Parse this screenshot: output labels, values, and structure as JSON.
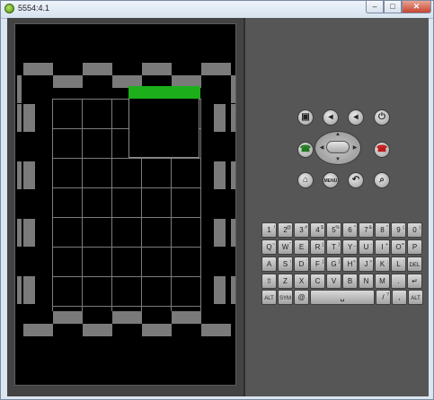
{
  "window": {
    "title": "5554:4.1",
    "minimize_label": "–",
    "maximize_label": "□",
    "close_label": "✕"
  },
  "colors": {
    "dialog_bar": "#1cae1b",
    "checker_cell": "#7a7a7a",
    "screen_bg": "#000000",
    "panel_bg": "#565656"
  },
  "hardware_buttons": {
    "row1": [
      {
        "name": "camera-button",
        "icon": "camera-icon",
        "glyph": "▣"
      },
      {
        "name": "volume-down-button",
        "icon": "volume-down-icon",
        "glyph": "◂"
      },
      {
        "name": "volume-up-button",
        "icon": "volume-up-icon",
        "glyph": "◂"
      },
      {
        "name": "power-button",
        "icon": "power-icon",
        "glyph": "⏻"
      }
    ],
    "call": {
      "glyph": "☎"
    },
    "end_call": {
      "glyph": "☎"
    },
    "row3": [
      {
        "name": "home-button",
        "icon": "home-icon",
        "glyph": "⌂"
      },
      {
        "name": "menu-button",
        "icon": "menu-icon",
        "glyph": "MENU"
      },
      {
        "name": "back-button",
        "icon": "back-icon",
        "glyph": "↶"
      },
      {
        "name": "search-button",
        "icon": "search-icon",
        "glyph": "⌕"
      }
    ]
  },
  "keyboard": {
    "row1": [
      {
        "k": "1",
        "s": "!"
      },
      {
        "k": "2",
        "s": "@"
      },
      {
        "k": "3",
        "s": "#"
      },
      {
        "k": "4",
        "s": "$"
      },
      {
        "k": "5",
        "s": "%"
      },
      {
        "k": "6",
        "s": "^"
      },
      {
        "k": "7",
        "s": "&"
      },
      {
        "k": "8",
        "s": "*"
      },
      {
        "k": "9",
        "s": "("
      },
      {
        "k": "0",
        "s": ")"
      }
    ],
    "row2": [
      {
        "k": "Q",
        "s": "~"
      },
      {
        "k": "W",
        "s": "\""
      },
      {
        "k": "E",
        "s": "`"
      },
      {
        "k": "R",
        "s": "{"
      },
      {
        "k": "T",
        "s": "}"
      },
      {
        "k": "Y",
        "s": "_"
      },
      {
        "k": "U",
        "s": "-"
      },
      {
        "k": "I",
        "s": "+"
      },
      {
        "k": "O",
        "s": "="
      },
      {
        "k": "P",
        "s": ""
      }
    ],
    "row3": [
      {
        "k": "A",
        "s": ""
      },
      {
        "k": "S",
        "s": "\\"
      },
      {
        "k": "D",
        "s": "'"
      },
      {
        "k": "F",
        "s": "["
      },
      {
        "k": "G",
        "s": "]"
      },
      {
        "k": "H",
        "s": "<"
      },
      {
        "k": "J",
        "s": ">"
      },
      {
        "k": "K",
        "s": ";"
      },
      {
        "k": "L",
        "s": ":"
      },
      {
        "k": "DEL",
        "s": ""
      }
    ],
    "row4": [
      {
        "k": "⇧",
        "s": ""
      },
      {
        "k": "Z",
        "s": ""
      },
      {
        "k": "X",
        "s": ""
      },
      {
        "k": "C",
        "s": ""
      },
      {
        "k": "V",
        "s": ""
      },
      {
        "k": "B",
        "s": ""
      },
      {
        "k": "N",
        "s": ""
      },
      {
        "k": "M",
        "s": ""
      },
      {
        "k": ".",
        "s": ""
      },
      {
        "k": "↵",
        "s": ""
      }
    ],
    "row5": [
      {
        "k": "ALT",
        "s": ""
      },
      {
        "k": "SYM",
        "s": ""
      },
      {
        "k": "@",
        "s": ""
      },
      {
        "k": "␣",
        "s": ""
      },
      {
        "k": "/",
        "s": "?"
      },
      {
        "k": ",",
        "s": ""
      },
      {
        "k": "ALT",
        "s": ""
      }
    ]
  }
}
